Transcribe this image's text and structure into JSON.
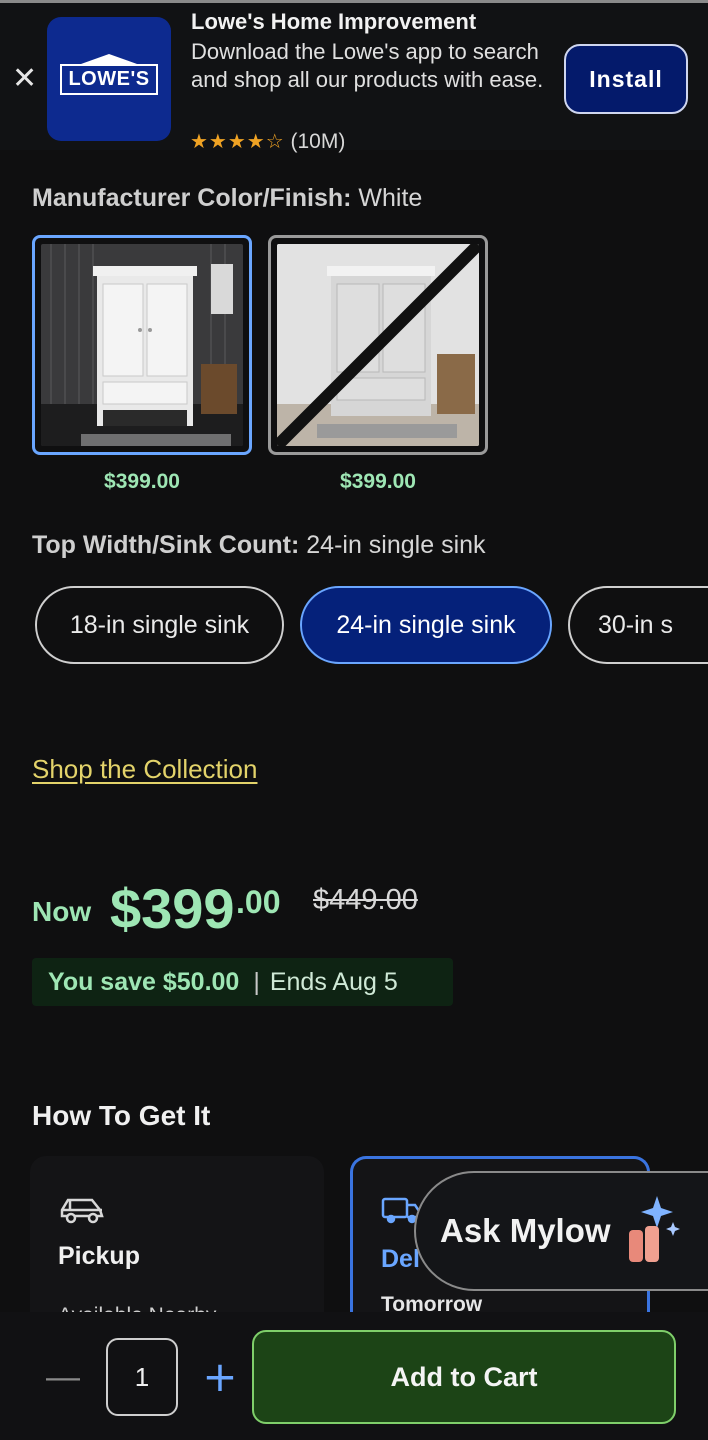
{
  "banner": {
    "close_glyph": "✕",
    "logo_text": "LOWE'S",
    "app_title": "Lowe's Home Improvement",
    "description": "Download the Lowe's app to search and shop all our products with ease.",
    "stars": "★★★★☆",
    "rating_value": 4.5,
    "rating_count": "(10M)",
    "install_label": "Install"
  },
  "color_finish": {
    "label": "Manufacturer Color/Finish:",
    "value": "White",
    "options": [
      {
        "price": "$399.00",
        "selected": true,
        "available": true
      },
      {
        "price": "$399.00",
        "selected": false,
        "available": false
      }
    ]
  },
  "sink": {
    "label": "Top Width/Sink Count:",
    "value": "24-in single sink",
    "options": [
      {
        "label": "18-in single sink",
        "selected": false
      },
      {
        "label": "24-in single sink",
        "selected": true
      },
      {
        "label": "30-in s",
        "selected": false
      }
    ]
  },
  "collection_link": "Shop the Collection",
  "price": {
    "now_label": "Now",
    "dollars": "$399",
    "cents": ".00",
    "was": "$449.00",
    "save": "You save $50.00",
    "separator": "|",
    "ends": "Ends Aug 5"
  },
  "fulfillment": {
    "title": "How To Get It",
    "pickup": {
      "title": "Pickup",
      "sub": "Available Nearby"
    },
    "delivery": {
      "title": "Del",
      "sub": "Tomorrow"
    }
  },
  "mylow": {
    "label": "Ask Mylow"
  },
  "cart": {
    "minus": "—",
    "quantity": "1",
    "plus": "+",
    "add_label": "Add to Cart"
  },
  "colors": {
    "accent_green": "#9ee6b4",
    "selected_blue": "#05217a",
    "link_yellow": "#e3d36a",
    "cart_green": "#1c4416"
  }
}
